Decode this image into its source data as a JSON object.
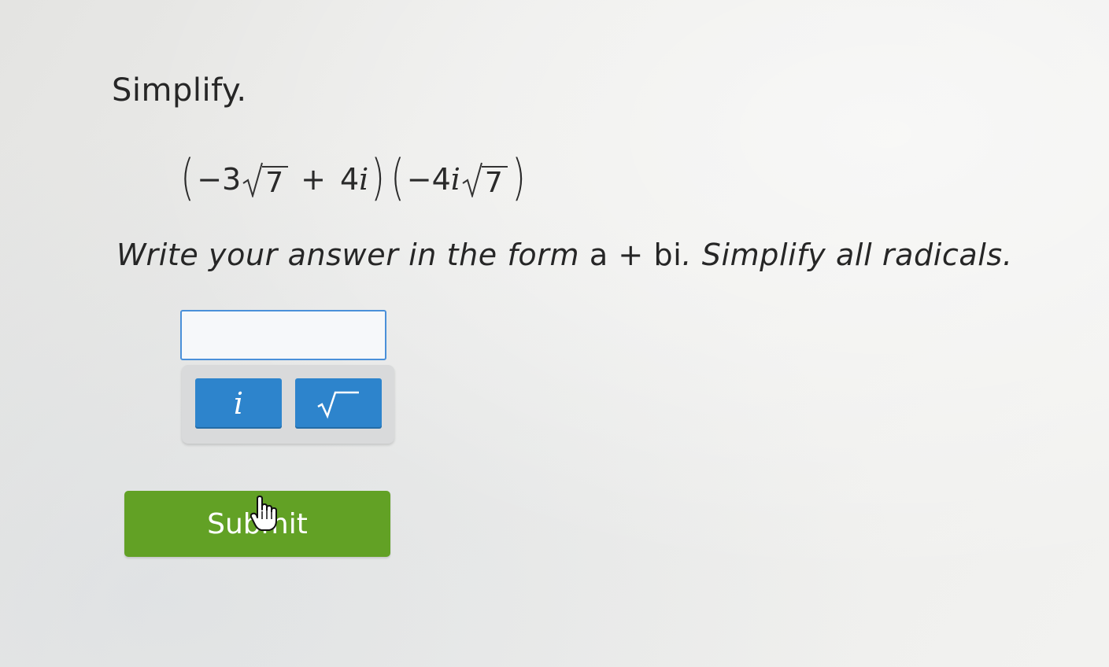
{
  "question": {
    "prompt": "Simplify.",
    "expression": {
      "open_paren_1": "(",
      "term1_coef": "−3",
      "term1_radicand": "7",
      "plus": "+",
      "term2": "4",
      "term2_var": "i",
      "close_paren_1": ")",
      "open_paren_2": "(",
      "term3_coef": "−4",
      "term3_var": "i",
      "term3_radicand": "7",
      "close_paren_2": ")"
    },
    "instructions_pre": "Write your answer in the form ",
    "instructions_form": "a + bi",
    "instructions_post": ". Simplify all radicals."
  },
  "answer": {
    "value": ""
  },
  "keypad": {
    "i_key_label": "i",
    "sqrt_key_icon": "square-root-icon"
  },
  "actions": {
    "submit_label": "Submit"
  },
  "cursor": {
    "icon": "hand-pointer-icon"
  },
  "colors": {
    "submit_green": "#62a125",
    "key_blue": "#2d84cc",
    "input_border": "#4a90d9"
  }
}
